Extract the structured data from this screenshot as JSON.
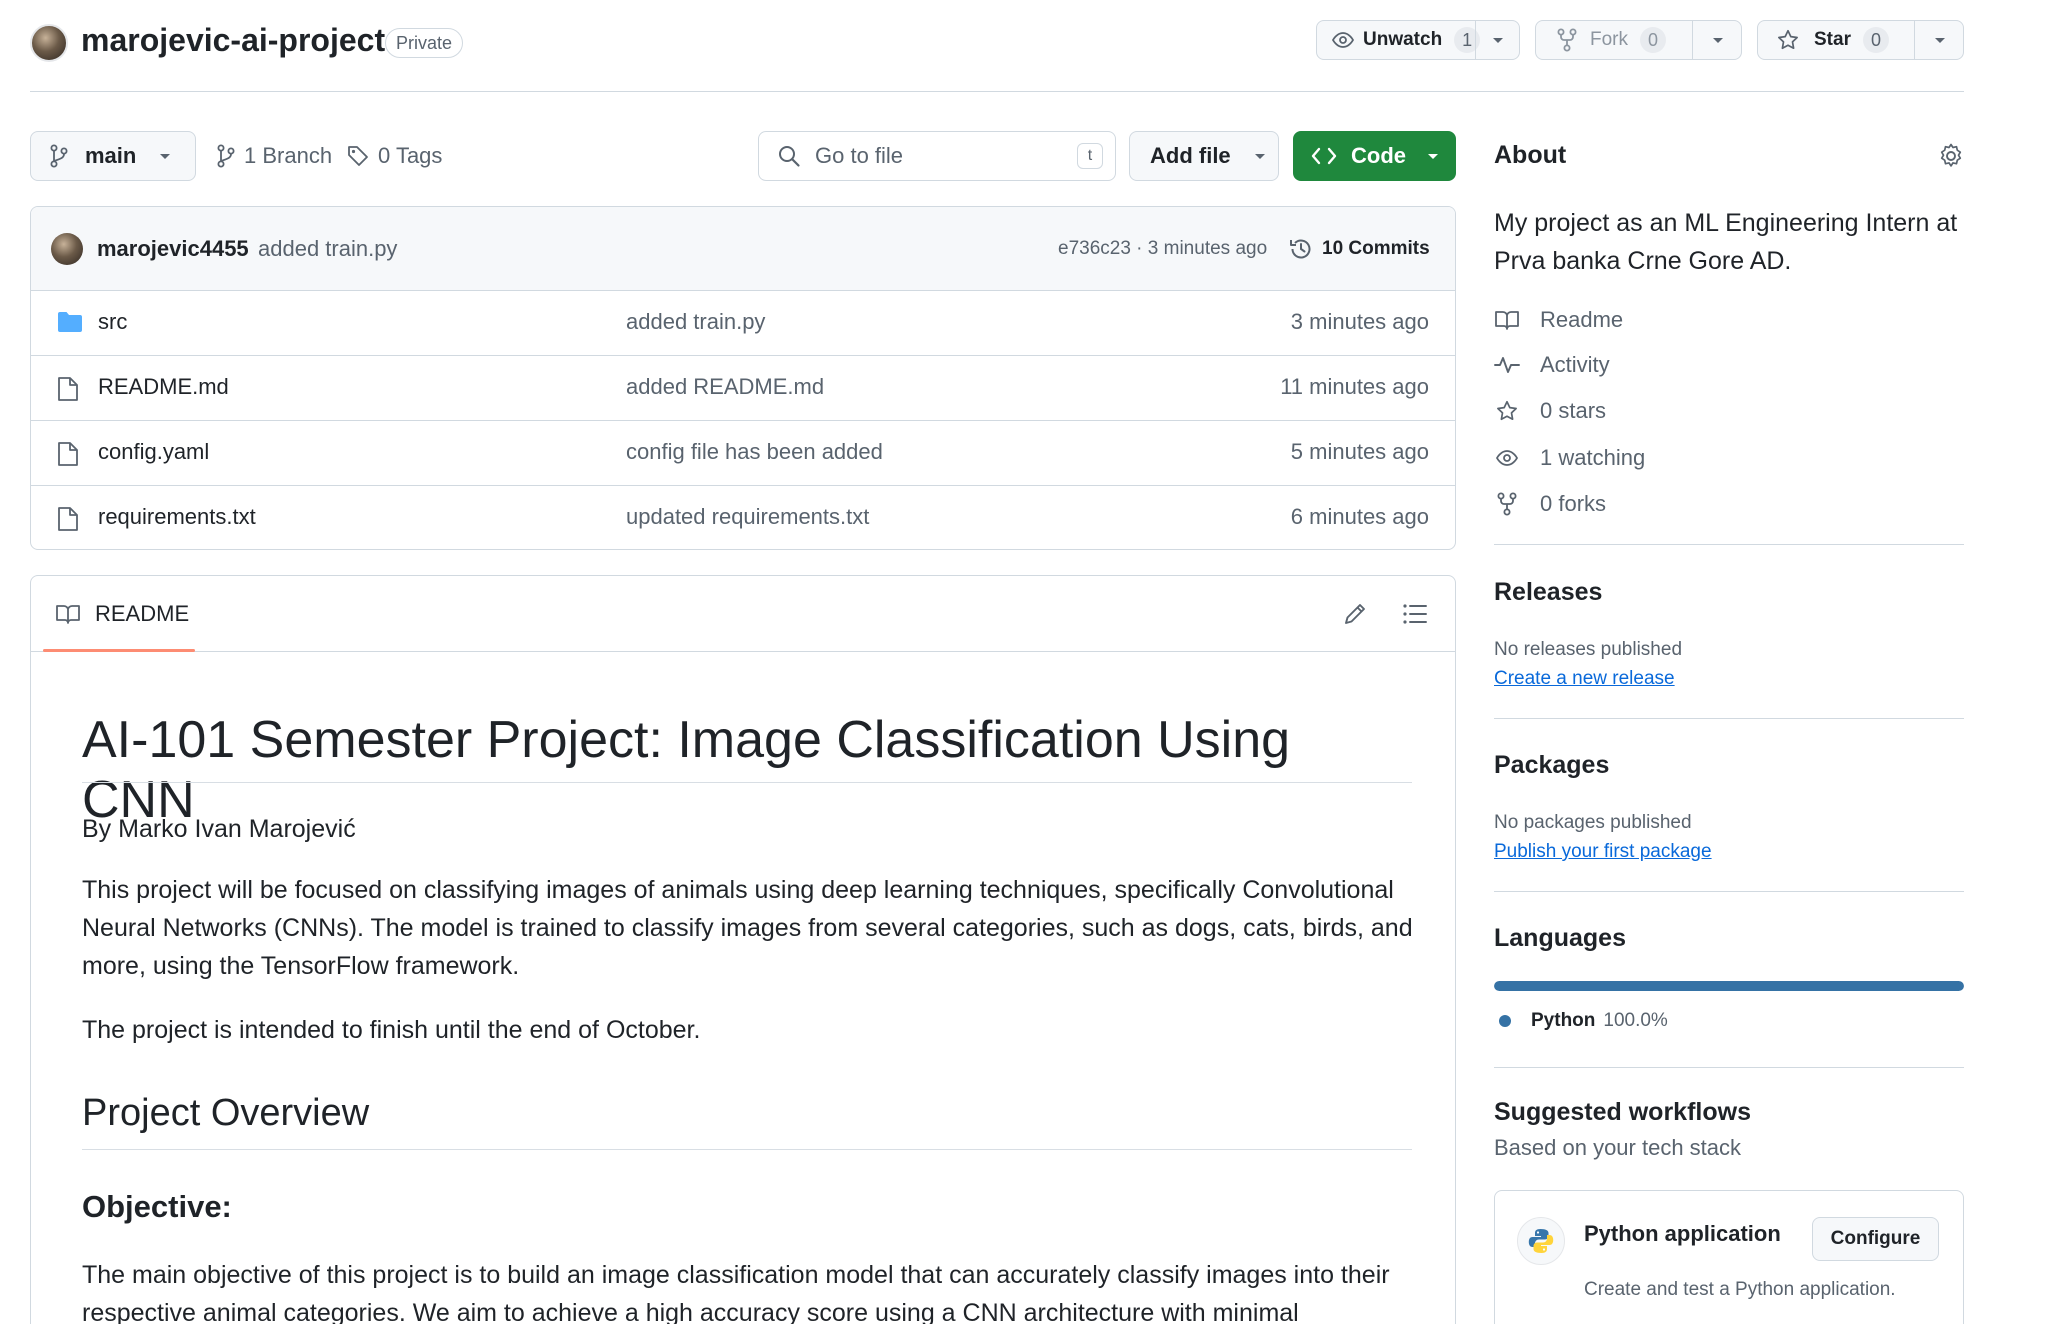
{
  "repo": {
    "name": "marojevic-ai-project",
    "visibility": "Private"
  },
  "header_actions": {
    "watch": {
      "label": "Unwatch",
      "count": "1"
    },
    "fork": {
      "label": "Fork",
      "count": "0"
    },
    "star": {
      "label": "Star",
      "count": "0"
    }
  },
  "toolbar": {
    "branch": "main",
    "branches": "1 Branch",
    "tags": "0 Tags",
    "goto_placeholder": "Go to file",
    "goto_shortcut": "t",
    "add_file": "Add file",
    "code": "Code"
  },
  "latest_commit": {
    "author": "marojevic4455",
    "message": "added train.py",
    "hash_time": "e736c23 · 3 minutes ago",
    "commits": "10 Commits"
  },
  "files": [
    {
      "name": "src",
      "type": "dir",
      "message": "added train.py",
      "time": "3 minutes ago"
    },
    {
      "name": "README.md",
      "type": "file",
      "message": "added README.md",
      "time": "11 minutes ago"
    },
    {
      "name": "config.yaml",
      "type": "file",
      "message": "config file has been added",
      "time": "5 minutes ago"
    },
    {
      "name": "requirements.txt",
      "type": "file",
      "message": "updated requirements.txt",
      "time": "6 minutes ago"
    }
  ],
  "readme": {
    "tab_label": "README",
    "h1": "AI-101 Semester Project: Image Classification Using CNN",
    "byline": "By Marko Ivan Marojević",
    "para1": "This project will be focused on classifying images of animals using deep learning techniques, specifically Convolutional Neural Networks (CNNs). The model is trained to classify images from several categories, such as dogs, cats, birds, and more, using the TensorFlow framework.",
    "para2": "The project is intended to finish until the end of October.",
    "h2": "Project Overview",
    "h3": "Objective:",
    "para3": "The main objective of this project is to build an image classification model that can accurately classify images into their respective animal categories. We aim to achieve a high accuracy score using a CNN architecture with minimal"
  },
  "about": {
    "title": "About",
    "description": "My project as an ML Engineering Intern at Prva banka Crne Gore AD.",
    "items": [
      {
        "icon": "book-icon",
        "label": "Readme"
      },
      {
        "icon": "pulse-icon",
        "label": "Activity"
      },
      {
        "icon": "star-icon",
        "label": "0 stars"
      },
      {
        "icon": "eye-icon",
        "label": "1 watching"
      },
      {
        "icon": "fork-icon",
        "label": "0 forks"
      }
    ]
  },
  "releases": {
    "title": "Releases",
    "empty": "No releases published",
    "link": "Create a new release"
  },
  "packages": {
    "title": "Packages",
    "empty": "No packages published",
    "link": "Publish your first package"
  },
  "languages": {
    "title": "Languages",
    "items": [
      {
        "name": "Python",
        "percent": "100.0%",
        "fraction": 1.0,
        "color": "#3572A5"
      }
    ]
  },
  "workflows": {
    "title": "Suggested workflows",
    "subtitle": "Based on your tech stack",
    "card": {
      "title": "Python application",
      "description": "Create and test a Python application.",
      "button": "Configure"
    }
  },
  "colors": {
    "accent_green": "#1f883d",
    "link_blue": "#0969da",
    "python_blue": "#3572A5",
    "tab_underline": "#fd8c73"
  }
}
